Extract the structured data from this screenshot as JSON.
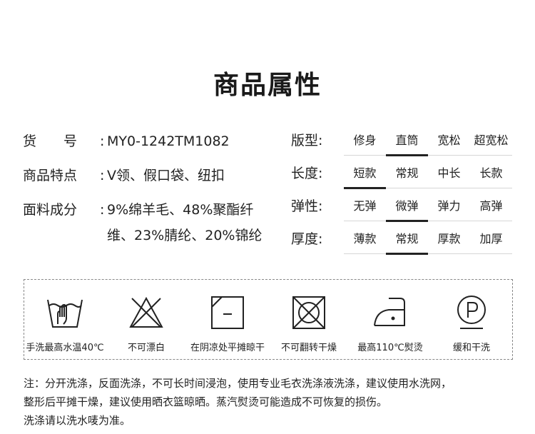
{
  "title": "商品属性",
  "specs": [
    {
      "label": "货　　号",
      "colon": ":",
      "value": "MY0-1242TM1082"
    },
    {
      "label": "商品特点",
      "colon": ":",
      "value": "V领、假口袋、纽扣"
    },
    {
      "label": "面料成分",
      "colon": ":",
      "value": "9%绵羊毛、48%聚酯纤维、23%腈纶、20%锦纶"
    }
  ],
  "attributes": [
    {
      "label": "版型:",
      "options": [
        "修身",
        "直筒",
        "宽松",
        "超宽松"
      ],
      "selected": 1
    },
    {
      "label": "长度:",
      "options": [
        "短款",
        "常规",
        "中长",
        "长款"
      ],
      "selected": 0
    },
    {
      "label": "弹性:",
      "options": [
        "无弹",
        "微弹",
        "弹力",
        "高弹"
      ],
      "selected": 1
    },
    {
      "label": "厚度:",
      "options": [
        "薄款",
        "常规",
        "厚款",
        "加厚"
      ],
      "selected": 1
    }
  ],
  "care": [
    {
      "icon": "hand-wash-icon",
      "label": "手洗最高水温40℃"
    },
    {
      "icon": "no-bleach-icon",
      "label": "不可漂白"
    },
    {
      "icon": "shade-dry-flat-icon",
      "label": "在阴凉处平摊晾干"
    },
    {
      "icon": "no-tumble-dry-icon",
      "label": "不可翻转干燥"
    },
    {
      "icon": "iron-110-icon",
      "label": "最高110℃熨烫"
    },
    {
      "icon": "gentle-dry-clean-icon",
      "label": "缓和干洗"
    }
  ],
  "note": {
    "line1": "注：分开洗涤，反面洗涤，不可长时间浸泡，使用专业毛衣洗涤液洗涤，建议使用水洗网，",
    "line2": "整形后平摊干燥，建议使用晒衣篮晾晒。蒸汽熨烫可能造成不可恢复的损伤。",
    "line3": "洗涤请以洗水唛为准。"
  }
}
